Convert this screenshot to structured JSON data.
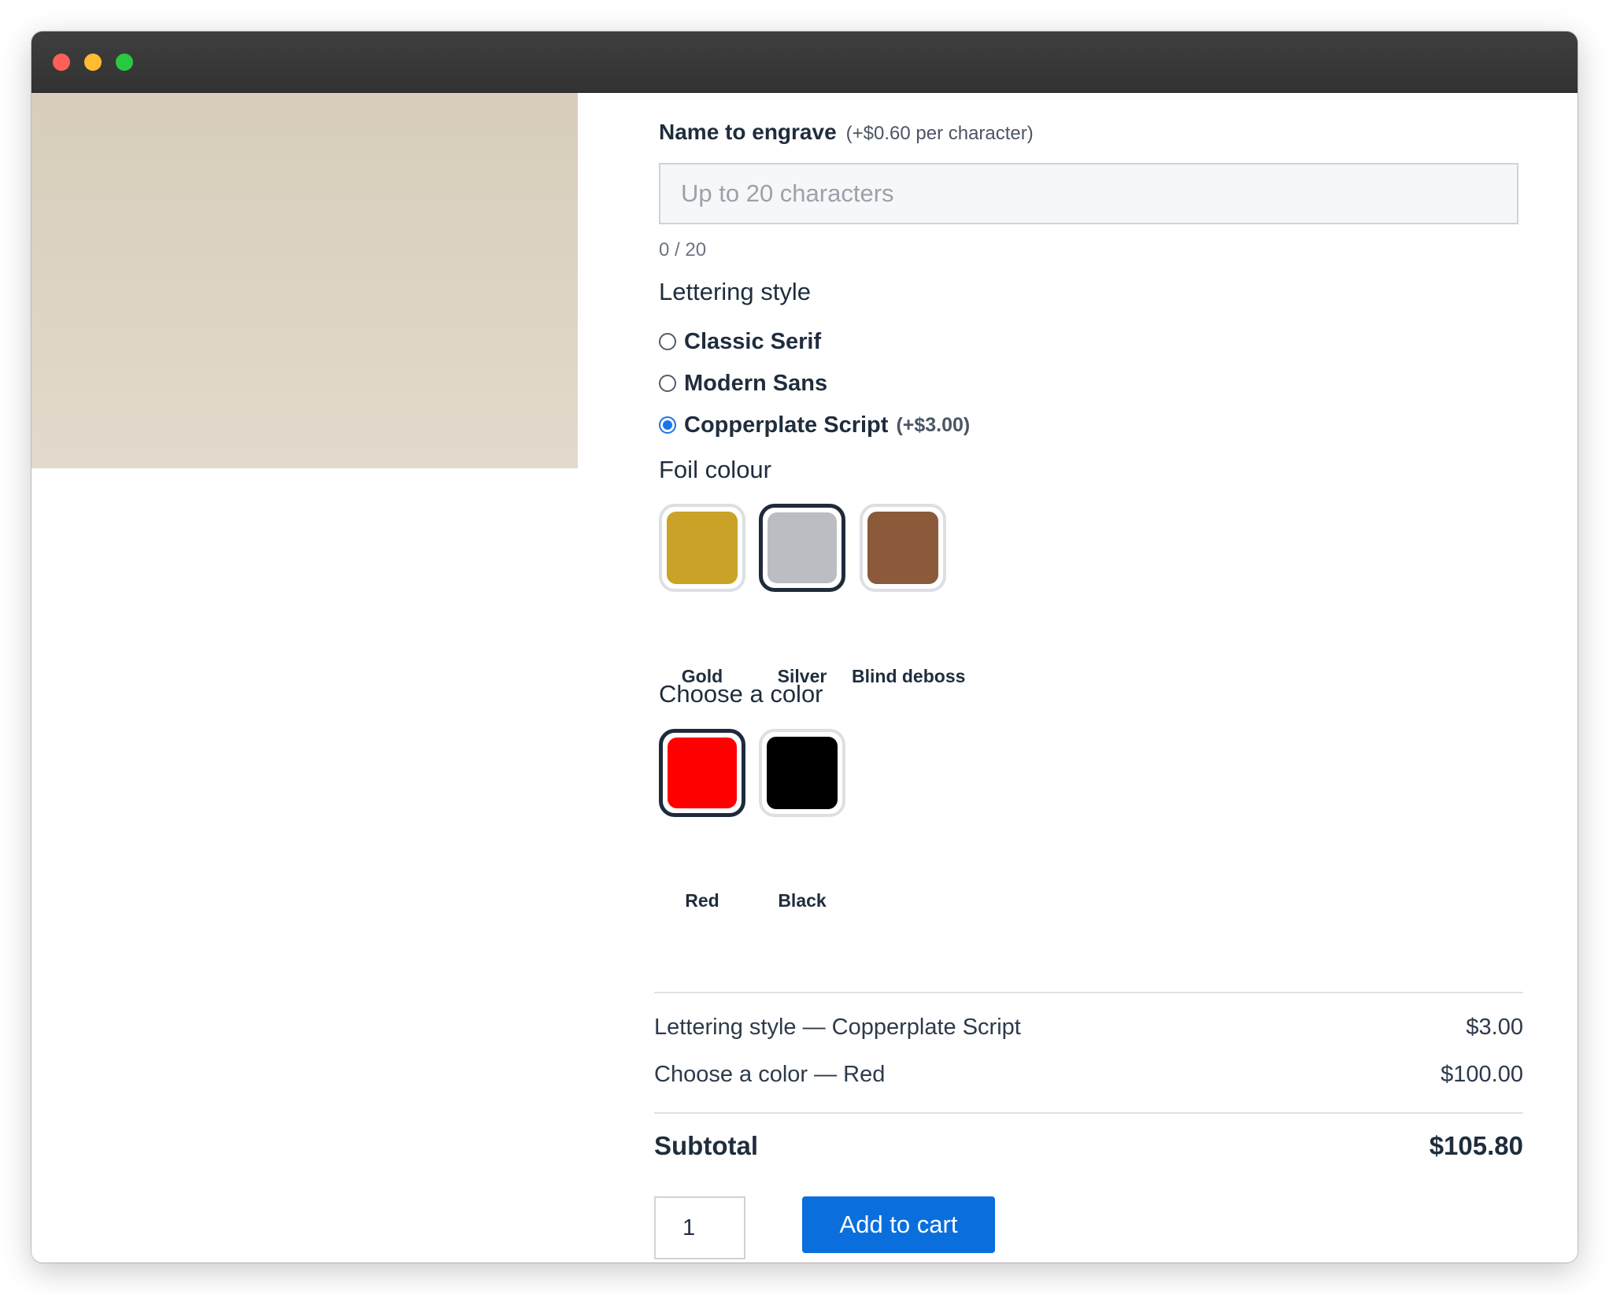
{
  "engrave": {
    "label": "Name to engrave",
    "hint": "(+$0.60 per character)",
    "value": "",
    "placeholder": "Up to 20 characters",
    "counter": "0 / 20"
  },
  "lettering": {
    "title": "Lettering style",
    "options": [
      {
        "label": "Classic Serif",
        "extra": "",
        "checked": false
      },
      {
        "label": "Modern Sans",
        "extra": "",
        "checked": false
      },
      {
        "label": "Copperplate Script",
        "extra": "(+$3.00)",
        "checked": true
      }
    ]
  },
  "foil": {
    "title": "Foil colour",
    "swatches": [
      {
        "label": "Gold",
        "color": "#c9a227",
        "selected": false
      },
      {
        "label": "Silver",
        "color": "#bbbdc2",
        "selected": true
      },
      {
        "label": "Blind deboss",
        "color": "#8b5a3a",
        "selected": false
      }
    ]
  },
  "color": {
    "title": "Choose a color",
    "swatches": [
      {
        "label": "Red",
        "color": "#ff0000",
        "selected": true
      },
      {
        "label": "Black",
        "color": "#000000",
        "selected": false
      }
    ]
  },
  "summary": {
    "lines": [
      {
        "name": "Lettering style — Copperplate Script",
        "price": "$3.00"
      },
      {
        "name": "Choose a color — Red",
        "price": "$100.00"
      }
    ],
    "subtotal_label": "Subtotal",
    "subtotal_value": "$105.80"
  },
  "cart": {
    "quantity": "1",
    "button_label": "Add to cart"
  },
  "colors": {
    "accent": "#0a6fdd",
    "radio_checked": "#1a73e8",
    "product_image": "#d9cfbe"
  }
}
